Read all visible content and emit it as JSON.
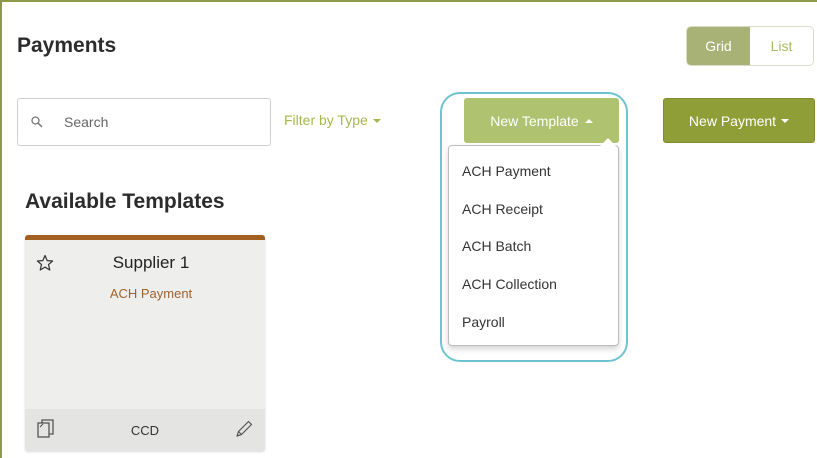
{
  "header": {
    "title": "Payments"
  },
  "view_toggle": {
    "grid_label": "Grid",
    "list_label": "List",
    "selected": "Grid"
  },
  "search": {
    "placeholder": "Search",
    "icon": "search-icon"
  },
  "filter": {
    "label": "Filter by Type"
  },
  "new_template": {
    "label": "New Template",
    "menu_items": [
      "ACH Payment",
      "ACH Receipt",
      "ACH Batch",
      "ACH Collection",
      "Payroll"
    ]
  },
  "new_payment": {
    "label": "New Payment"
  },
  "section": {
    "title": "Available Templates"
  },
  "templates": [
    {
      "name": "Supplier 1",
      "type": "ACH Payment",
      "format": "CCD"
    }
  ],
  "colors": {
    "accent_green": "#aec270",
    "dark_green": "#909e37",
    "card_accent": "#a35f22",
    "highlight_ring": "#6fc3cf"
  }
}
